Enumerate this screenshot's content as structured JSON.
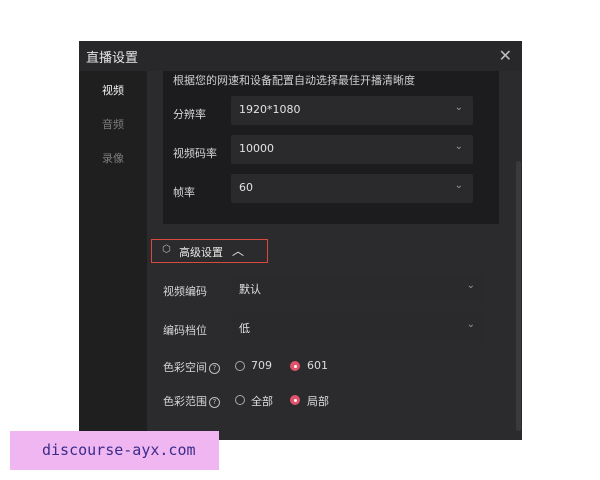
{
  "dialog": {
    "title": "直播设置",
    "close_glyph": "✕"
  },
  "sidebar": {
    "items": [
      {
        "label": "视频",
        "active": true
      },
      {
        "label": "音频",
        "active": false
      },
      {
        "label": "录像",
        "active": false
      }
    ]
  },
  "basic": {
    "hint": "根据您的网速和设备配置自动选择最佳开播清晰度",
    "rows": [
      {
        "label": "分辨率",
        "value": "1920*1080"
      },
      {
        "label": "视频码率",
        "value": "10000"
      },
      {
        "label": "帧率",
        "value": "60"
      }
    ]
  },
  "advanced": {
    "toggle_label": "高级设置",
    "icon": "hexagon-settings-icon",
    "expanded": true,
    "rows": [
      {
        "label": "视频编码",
        "value": "默认"
      },
      {
        "label": "编码档位",
        "value": "低"
      }
    ],
    "color_space": {
      "label": "色彩空间",
      "options": [
        "709",
        "601"
      ],
      "selected": "601"
    },
    "color_range": {
      "label": "色彩范围",
      "options": [
        "全部",
        "局部"
      ],
      "selected": "局部"
    }
  },
  "watermark": {
    "text": "discourse-ayx.com"
  },
  "colors": {
    "accent": "#e0536a",
    "highlight_border": "#d94a3c",
    "dialog_bg": "#28282a",
    "watermark_bg": "#f0b6f2"
  }
}
